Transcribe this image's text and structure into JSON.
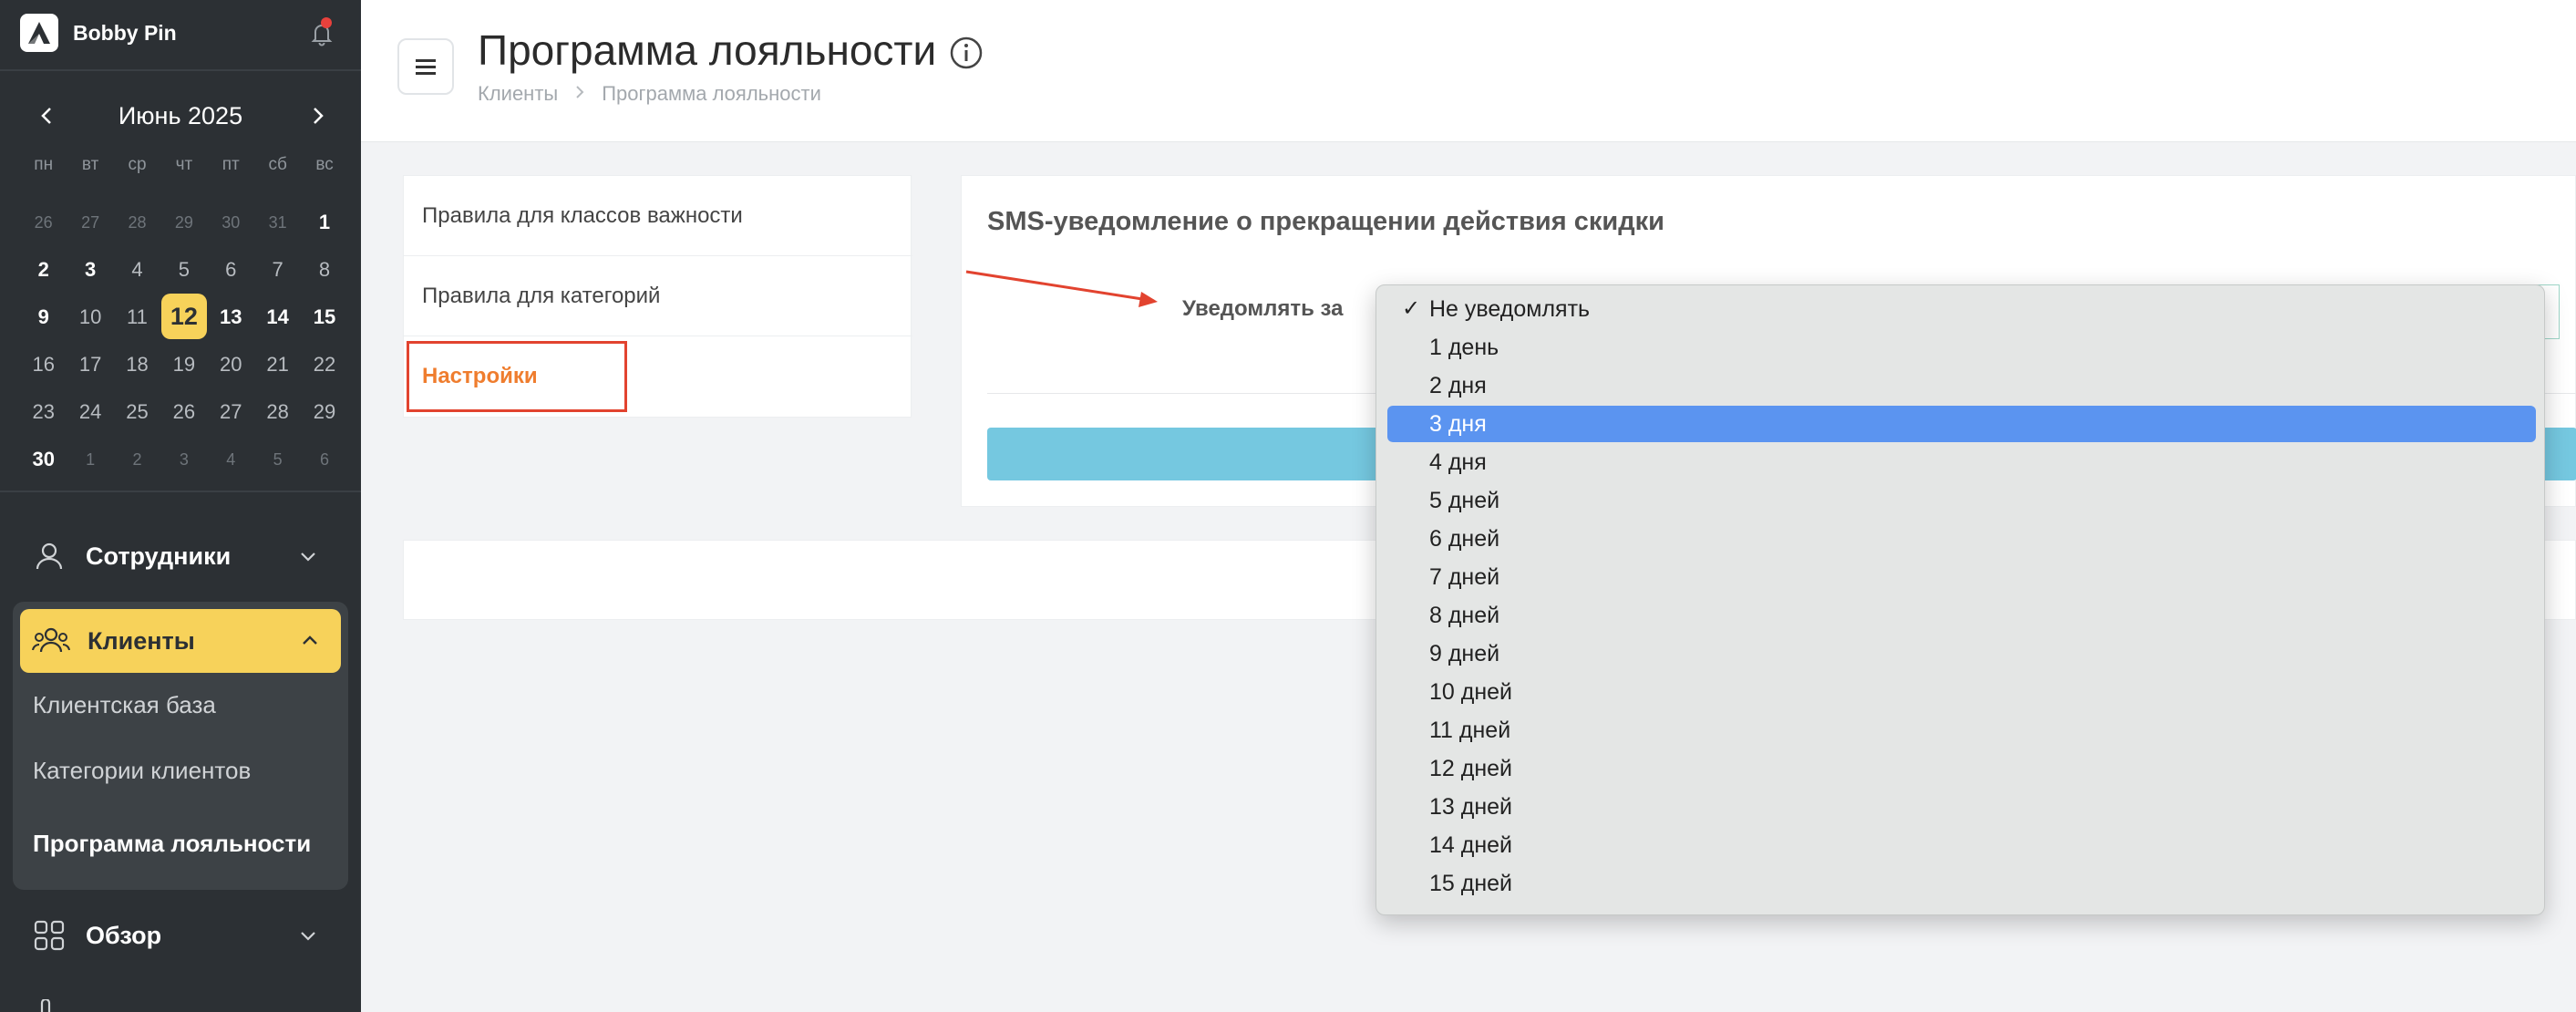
{
  "app": {
    "name": "Bobby Pin"
  },
  "calendar": {
    "title": "Июнь 2025",
    "weekdays": [
      "пн",
      "вт",
      "ср",
      "чт",
      "пт",
      "сб",
      "вс"
    ],
    "days": [
      {
        "d": "26",
        "s": "muted"
      },
      {
        "d": "27",
        "s": "muted"
      },
      {
        "d": "28",
        "s": "muted"
      },
      {
        "d": "29",
        "s": "muted"
      },
      {
        "d": "30",
        "s": "muted"
      },
      {
        "d": "31",
        "s": "muted"
      },
      {
        "d": "1",
        "s": "bold"
      },
      {
        "d": "2",
        "s": "bold"
      },
      {
        "d": "3",
        "s": "bold"
      },
      {
        "d": "4",
        "s": ""
      },
      {
        "d": "5",
        "s": ""
      },
      {
        "d": "6",
        "s": ""
      },
      {
        "d": "7",
        "s": ""
      },
      {
        "d": "8",
        "s": ""
      },
      {
        "d": "9",
        "s": "bold"
      },
      {
        "d": "10",
        "s": ""
      },
      {
        "d": "11",
        "s": ""
      },
      {
        "d": "12",
        "s": "today"
      },
      {
        "d": "13",
        "s": "bold"
      },
      {
        "d": "14",
        "s": "bold"
      },
      {
        "d": "15",
        "s": "bold"
      },
      {
        "d": "16",
        "s": ""
      },
      {
        "d": "17",
        "s": ""
      },
      {
        "d": "18",
        "s": ""
      },
      {
        "d": "19",
        "s": ""
      },
      {
        "d": "20",
        "s": ""
      },
      {
        "d": "21",
        "s": ""
      },
      {
        "d": "22",
        "s": ""
      },
      {
        "d": "23",
        "s": ""
      },
      {
        "d": "24",
        "s": ""
      },
      {
        "d": "25",
        "s": ""
      },
      {
        "d": "26",
        "s": ""
      },
      {
        "d": "27",
        "s": ""
      },
      {
        "d": "28",
        "s": ""
      },
      {
        "d": "29",
        "s": ""
      },
      {
        "d": "30",
        "s": "bold"
      },
      {
        "d": "1",
        "s": "muted"
      },
      {
        "d": "2",
        "s": "muted"
      },
      {
        "d": "3",
        "s": "muted"
      },
      {
        "d": "4",
        "s": "muted"
      },
      {
        "d": "5",
        "s": "muted"
      },
      {
        "d": "6",
        "s": "muted"
      }
    ]
  },
  "sidebar": {
    "employees": "Сотрудники",
    "clients": "Клиенты",
    "sub": [
      "Клиентская база",
      "Категории клиентов",
      "Программа лояльности"
    ],
    "overview": "Обзор"
  },
  "header": {
    "title": "Программа лояльности",
    "breadcrumb": [
      "Клиенты",
      "Программа лояльности"
    ]
  },
  "left_menu": [
    "Правила для классов важности",
    "Правила для категорий",
    "Настройки"
  ],
  "panel": {
    "title": "SMS-уведомление о прекращении действия скидки",
    "notify_label": "Уведомлять за"
  },
  "dropdown": {
    "checked_option": "Не уведомлять",
    "highlighted_option": "3 дня",
    "options": [
      "Не уведомлять",
      "1 день",
      "2 дня",
      "3 дня",
      "4 дня",
      "5 дней",
      "6 дней",
      "7 дней",
      "8 дней",
      "9 дней",
      "10 дней",
      "11 дней",
      "12 дней",
      "13 дней",
      "14 дней",
      "15 дней"
    ]
  },
  "colors": {
    "sidebar_bg": "#2c3034",
    "accent_yellow": "#f7d25a",
    "active_orange": "#ef7d2e",
    "highlight_blue": "#5b94f0",
    "annotation_red": "#e2432f",
    "save_button": "#75c8e0"
  }
}
